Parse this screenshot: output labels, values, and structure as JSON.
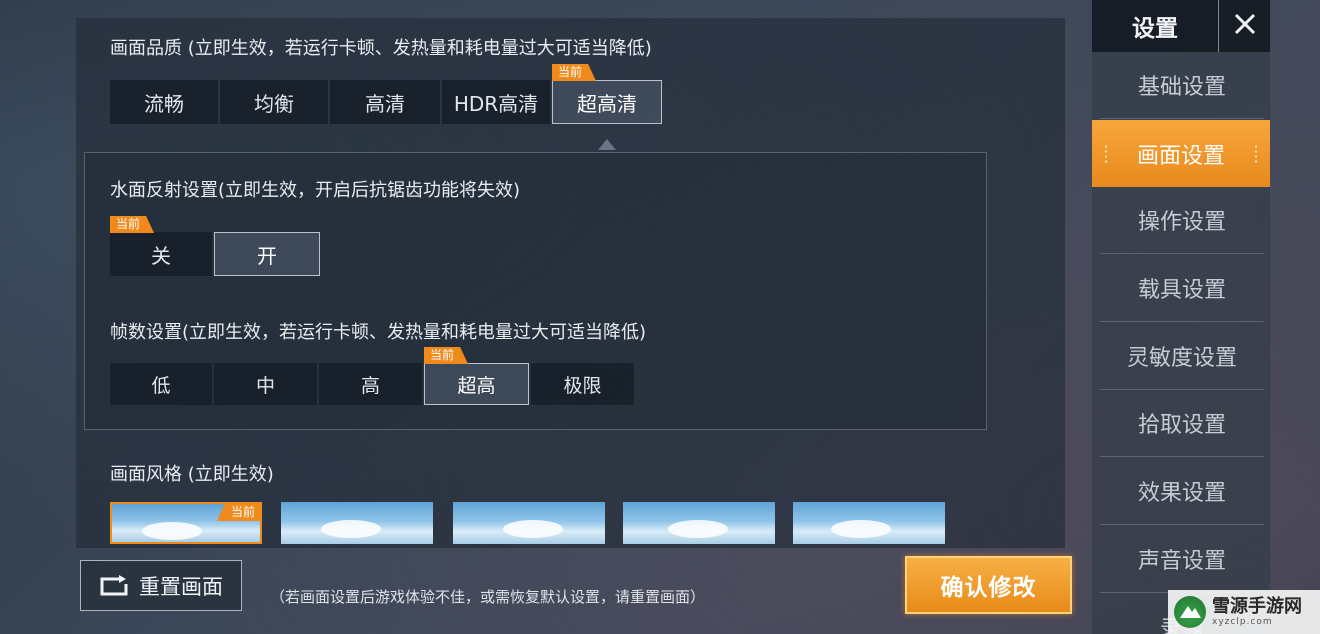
{
  "quality": {
    "title": "画面品质 (立即生效，若运行卡顿、发热量和耗电量过大可适当降低)",
    "options": [
      "流畅",
      "均衡",
      "高清",
      "HDR高清",
      "超高清"
    ],
    "current_badge": "当前"
  },
  "water": {
    "title": "水面反射设置(立即生效，开启后抗锯齿功能将失效)",
    "options": [
      "关",
      "开"
    ],
    "current_badge": "当前"
  },
  "fps": {
    "title": "帧数设置(立即生效，若运行卡顿、发热量和耗电量过大可适当降低)",
    "options": [
      "低",
      "中",
      "高",
      "超高",
      "极限"
    ],
    "current_badge": "当前"
  },
  "style": {
    "title": "画面风格 (立即生效)",
    "current_badge": "当前"
  },
  "bottom": {
    "reset_label": "重置画面",
    "hint": "（若画面设置后游戏体验不佳，或需恢复默认设置，请重置画面）",
    "confirm_label": "确认修改"
  },
  "sidebar": {
    "title": "设置",
    "items": [
      "基础设置",
      "画面设置",
      "操作设置",
      "载具设置",
      "灵敏度设置",
      "拾取设置",
      "效果设置",
      "声音设置",
      "录像"
    ]
  },
  "watermark": {
    "title": "雪源手游网",
    "sub": "xyzclp.com"
  },
  "colors": {
    "accent": "#f08a1c",
    "panel": "#262e3a"
  }
}
